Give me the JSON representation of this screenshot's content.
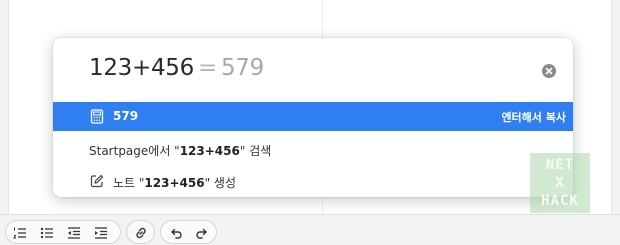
{
  "search": {
    "expression": "123+456",
    "equals": "=",
    "result": "579"
  },
  "selected_result": {
    "icon": "calculator-icon",
    "label": "579",
    "hint": "엔터해서 복사"
  },
  "options": {
    "startpage_prefix": "Startpage에서 \"",
    "startpage_query": "123+456",
    "startpage_suffix": "\" 검색",
    "note_icon": "note-edit-icon",
    "note_prefix": "노트 \"",
    "note_query": "123+456",
    "note_suffix": "\" 생성"
  },
  "toolbar": {
    "buttons": [
      "numbered-list-icon",
      "bullet-list-icon",
      "outdent-icon",
      "indent-icon",
      "link-icon",
      "undo-icon",
      "redo-icon"
    ]
  },
  "watermark": {
    "line1": "NET",
    "line2": "X",
    "line3": "HACK"
  },
  "colors": {
    "accent": "#2f7ff0"
  }
}
